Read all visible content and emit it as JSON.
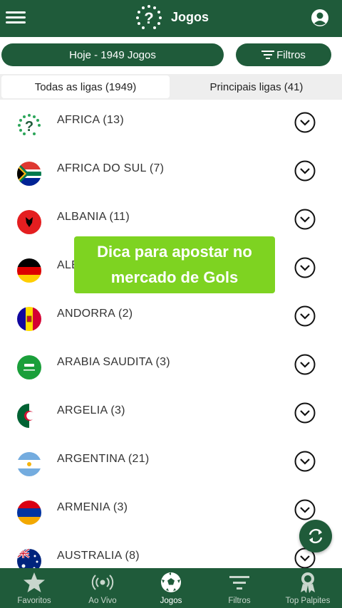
{
  "header": {
    "title": "Jogos",
    "menu_icon": "hamburger-icon",
    "logo_icon": "question-logo-icon",
    "profile_icon": "user-circle-icon"
  },
  "filters": {
    "date_label": "Hoje - 1949 Jogos",
    "filters_label": "Filtros"
  },
  "tabs": [
    {
      "label": "Todas as ligas (1949)",
      "active": true
    },
    {
      "label": "Principais ligas (41)",
      "active": false
    }
  ],
  "list": [
    {
      "label": "AFRICA (13)",
      "flag": "africa-icon"
    },
    {
      "label": "AFRICA DO SUL (7)",
      "flag": "south-africa-flag"
    },
    {
      "label": "ALBANIA (11)",
      "flag": "albania-flag"
    },
    {
      "label": "ALE",
      "flag": "germany-flag"
    },
    {
      "label": "ANDORRA (2)",
      "flag": "andorra-flag"
    },
    {
      "label": "ARABIA SAUDITA (3)",
      "flag": "saudi-arabia-flag"
    },
    {
      "label": "ARGELIA (3)",
      "flag": "algeria-flag"
    },
    {
      "label": "ARGENTINA (21)",
      "flag": "argentina-flag"
    },
    {
      "label": "ARMENIA (3)",
      "flag": "armenia-flag"
    },
    {
      "label": "AUSTRALIA (8)",
      "flag": "australia-flag"
    }
  ],
  "overlay": {
    "line1": "Dica para apostar no",
    "line2": "mercado de Gols"
  },
  "bottom_nav": [
    {
      "label": "Favoritos",
      "icon": "star-icon"
    },
    {
      "label": "Ao Vivo",
      "icon": "broadcast-icon"
    },
    {
      "label": "Jogos",
      "icon": "soccer-ball-icon",
      "active": true
    },
    {
      "label": "Filtros",
      "icon": "filter-icon"
    },
    {
      "label": "Top Palpites",
      "icon": "award-icon"
    }
  ],
  "colors": {
    "primary": "#1f5b3a",
    "overlay": "#7ed321"
  }
}
